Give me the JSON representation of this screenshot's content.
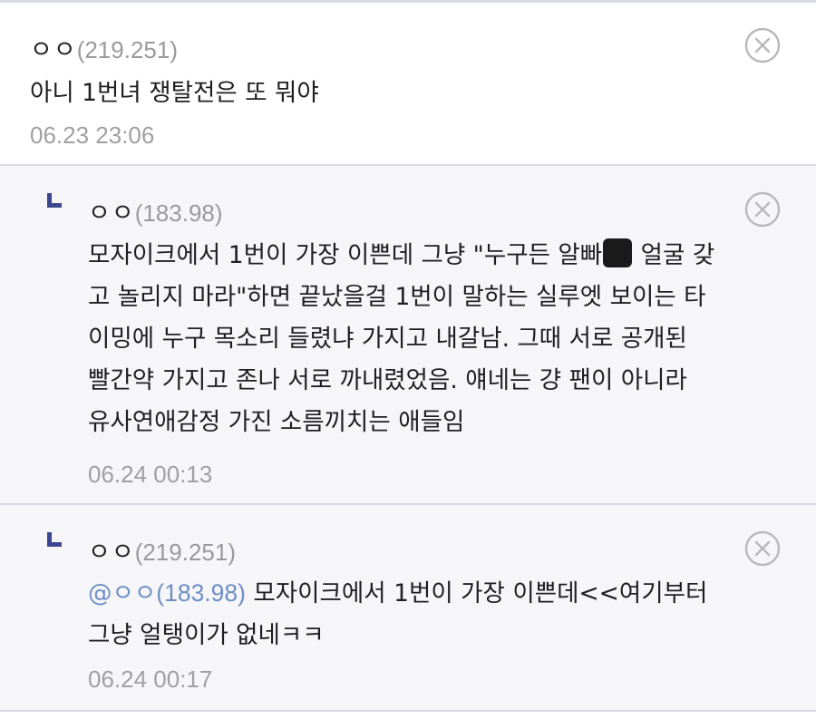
{
  "comments": [
    {
      "nick": "ㅇㅇ",
      "ip": "(219.251)",
      "body_lines": [
        "아니 1번녀 쟁탈전은 또 뭐야"
      ],
      "date": "06.23 23:06"
    },
    {
      "nick": "ㅇㅇ",
      "ip": "(183.98)",
      "body_lines": [
        "모자이크에서 1번이 가장 이쁜데 그냥 \"누구든 알빠",
        "얼굴 갖",
        "고 놀리지 마라\"하면 끝났을걸 1번이 말하는 실루엣 보이는 타",
        "이밍에 누구 목소리 들렸냐 가지고 내갈남. 그때 서로 공개된",
        "빨간약 가지고 존나 서로 까내렸었음. 얘네는 걍 팬이 아니라",
        "유사연애감정 가진 소름끼치는 애들임"
      ],
      "date": "06.24 00:13"
    },
    {
      "nick": "ㅇㅇ",
      "ip": "(219.251)",
      "mention_nick": "@ㅇㅇ",
      "mention_ip": "(183.98)",
      "body_lines": [
        "모자이크에서 1번이 가장 이쁜데<<여기부터",
        "그냥 얼탱이가 없네ㅋㅋ"
      ],
      "date": "06.24 00:17"
    }
  ],
  "icons": {
    "reply": "reply-arrow-icon",
    "delete": "close-circle-icon"
  },
  "colors": {
    "reply_arrow": "#3b4890",
    "mention": "#6e8fc4",
    "meta_gray": "#9a9a9a",
    "reply_bg": "#f6f6f9",
    "divider": "#d9dbe2"
  }
}
